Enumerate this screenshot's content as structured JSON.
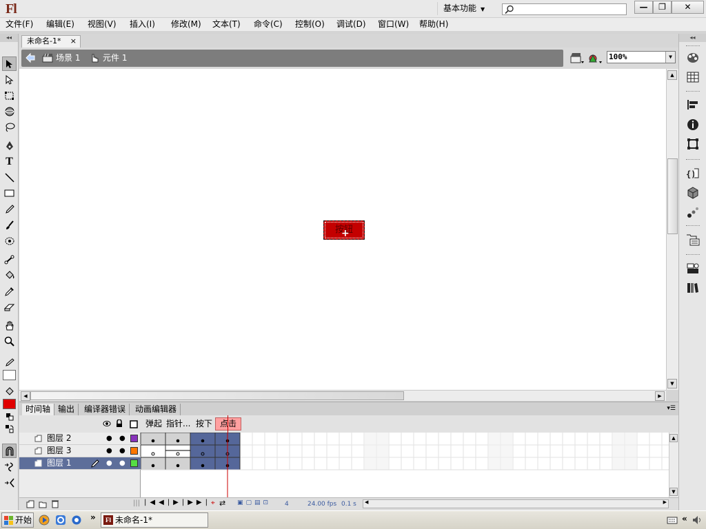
{
  "app": {
    "logo": "Fl",
    "workspace_label": "基本功能",
    "search_placeholder": ""
  },
  "window_controls": {
    "minimize": "—",
    "restore": "❐",
    "close": "✕"
  },
  "menu": [
    "文件(F)",
    "编辑(E)",
    "视图(V)",
    "插入(I)",
    "修改(M)",
    "文本(T)",
    "命令(C)",
    "控制(O)",
    "调试(D)",
    "窗口(W)",
    "帮助(H)"
  ],
  "document": {
    "tab_title": "未命名-1*",
    "tab_close": "×"
  },
  "editbar": {
    "scene_label": "场景 1",
    "symbol_label": "元件 1",
    "zoom": "100%"
  },
  "stage": {
    "button_text": "按钮"
  },
  "tools": {
    "icons": [
      "arrow-selection-icon",
      "subselection-icon",
      "free-transform-icon",
      "3d-rotation-icon",
      "lasso-icon",
      "pen-icon",
      "text-tool-icon",
      "line-tool-icon",
      "rectangle-tool-icon",
      "pencil-icon",
      "brush-icon",
      "deco-icon",
      "bone-icon",
      "paint-bucket-icon",
      "eyedropper-icon",
      "eraser-icon",
      "hand-icon",
      "zoom-icon"
    ],
    "stroke_color": "#ffffff",
    "fill_color": "#e00000"
  },
  "right_panel": {
    "icons": [
      "color-panel-icon",
      "swatches-icon",
      "align-icon",
      "info-icon",
      "transform-icon",
      "actions-icon",
      "components-icon",
      "motion-presets-icon",
      "library-icon",
      "project-icon",
      "movie-explorer-icon"
    ]
  },
  "timeline": {
    "tabs": [
      "时间轴",
      "输出",
      "编译器错误",
      "动画编辑器"
    ],
    "frame_labels": [
      "弹起",
      "指针...",
      "按下",
      "点击"
    ],
    "active_frame_label": "点击",
    "layers": [
      {
        "name": "图层 2",
        "color": "#8833bb",
        "selected": false
      },
      {
        "name": "图层 3",
        "color": "#ff7700",
        "selected": false
      },
      {
        "name": "图层 1",
        "color": "#55dd44",
        "selected": true
      }
    ],
    "footer": {
      "current_frame": "4",
      "fps": "24.00",
      "fps_unit": "fps",
      "time": "0.1 s"
    }
  },
  "taskbar": {
    "start_label": "开始",
    "task_label": "未命名-1*",
    "task_icon": "Fl",
    "more": "»"
  }
}
